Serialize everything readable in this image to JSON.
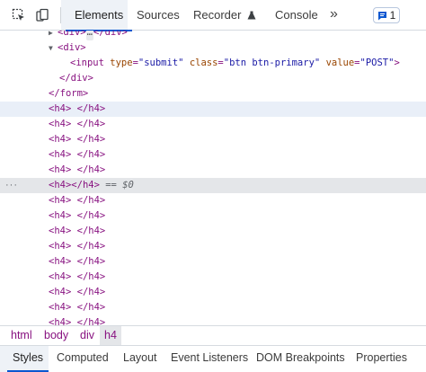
{
  "toolbar": {
    "inspect_icon": "inspect-element-icon",
    "device_icon": "device-toggle-icon",
    "tabs": [
      {
        "label": "Elements",
        "active": true
      },
      {
        "label": "Sources",
        "active": false
      },
      {
        "label": "Recorder",
        "active": false
      },
      {
        "label": "Console",
        "active": false
      }
    ],
    "more_tabs": "»",
    "issues_count": "1"
  },
  "dom_tree": {
    "collapsed_div": {
      "open": "<div>",
      "ellipsis": "…",
      "close": "</div>"
    },
    "open_div": "<div>",
    "input_line": {
      "tag": "input",
      "attrs": [
        {
          "name": "type",
          "value": "submit"
        },
        {
          "name": "class",
          "value": "btn btn-primary"
        },
        {
          "name": "value",
          "value": "POST"
        }
      ]
    },
    "close_div": "</div>",
    "close_form": "</form>",
    "h4_open": "<h4>",
    "h4_close": "</h4>",
    "selected_marker": "== $0",
    "dots": "···"
  },
  "breadcrumb": [
    {
      "label": "html",
      "active": false
    },
    {
      "label": "body",
      "active": false
    },
    {
      "label": "div",
      "active": false
    },
    {
      "label": "h4",
      "active": true
    }
  ],
  "bottom_tabs": [
    {
      "label": "Styles",
      "active": true
    },
    {
      "label": "Computed",
      "active": false
    },
    {
      "label": "Layout",
      "active": false
    },
    {
      "label": "Event Listeners",
      "active": false
    },
    {
      "label": "DOM Breakpoints",
      "active": false
    },
    {
      "label": "Properties",
      "active": false
    }
  ],
  "colors": {
    "accent": "#0b57d0",
    "tag": "#881280",
    "attr_name": "#994500",
    "attr_value": "#1a1aa6"
  }
}
